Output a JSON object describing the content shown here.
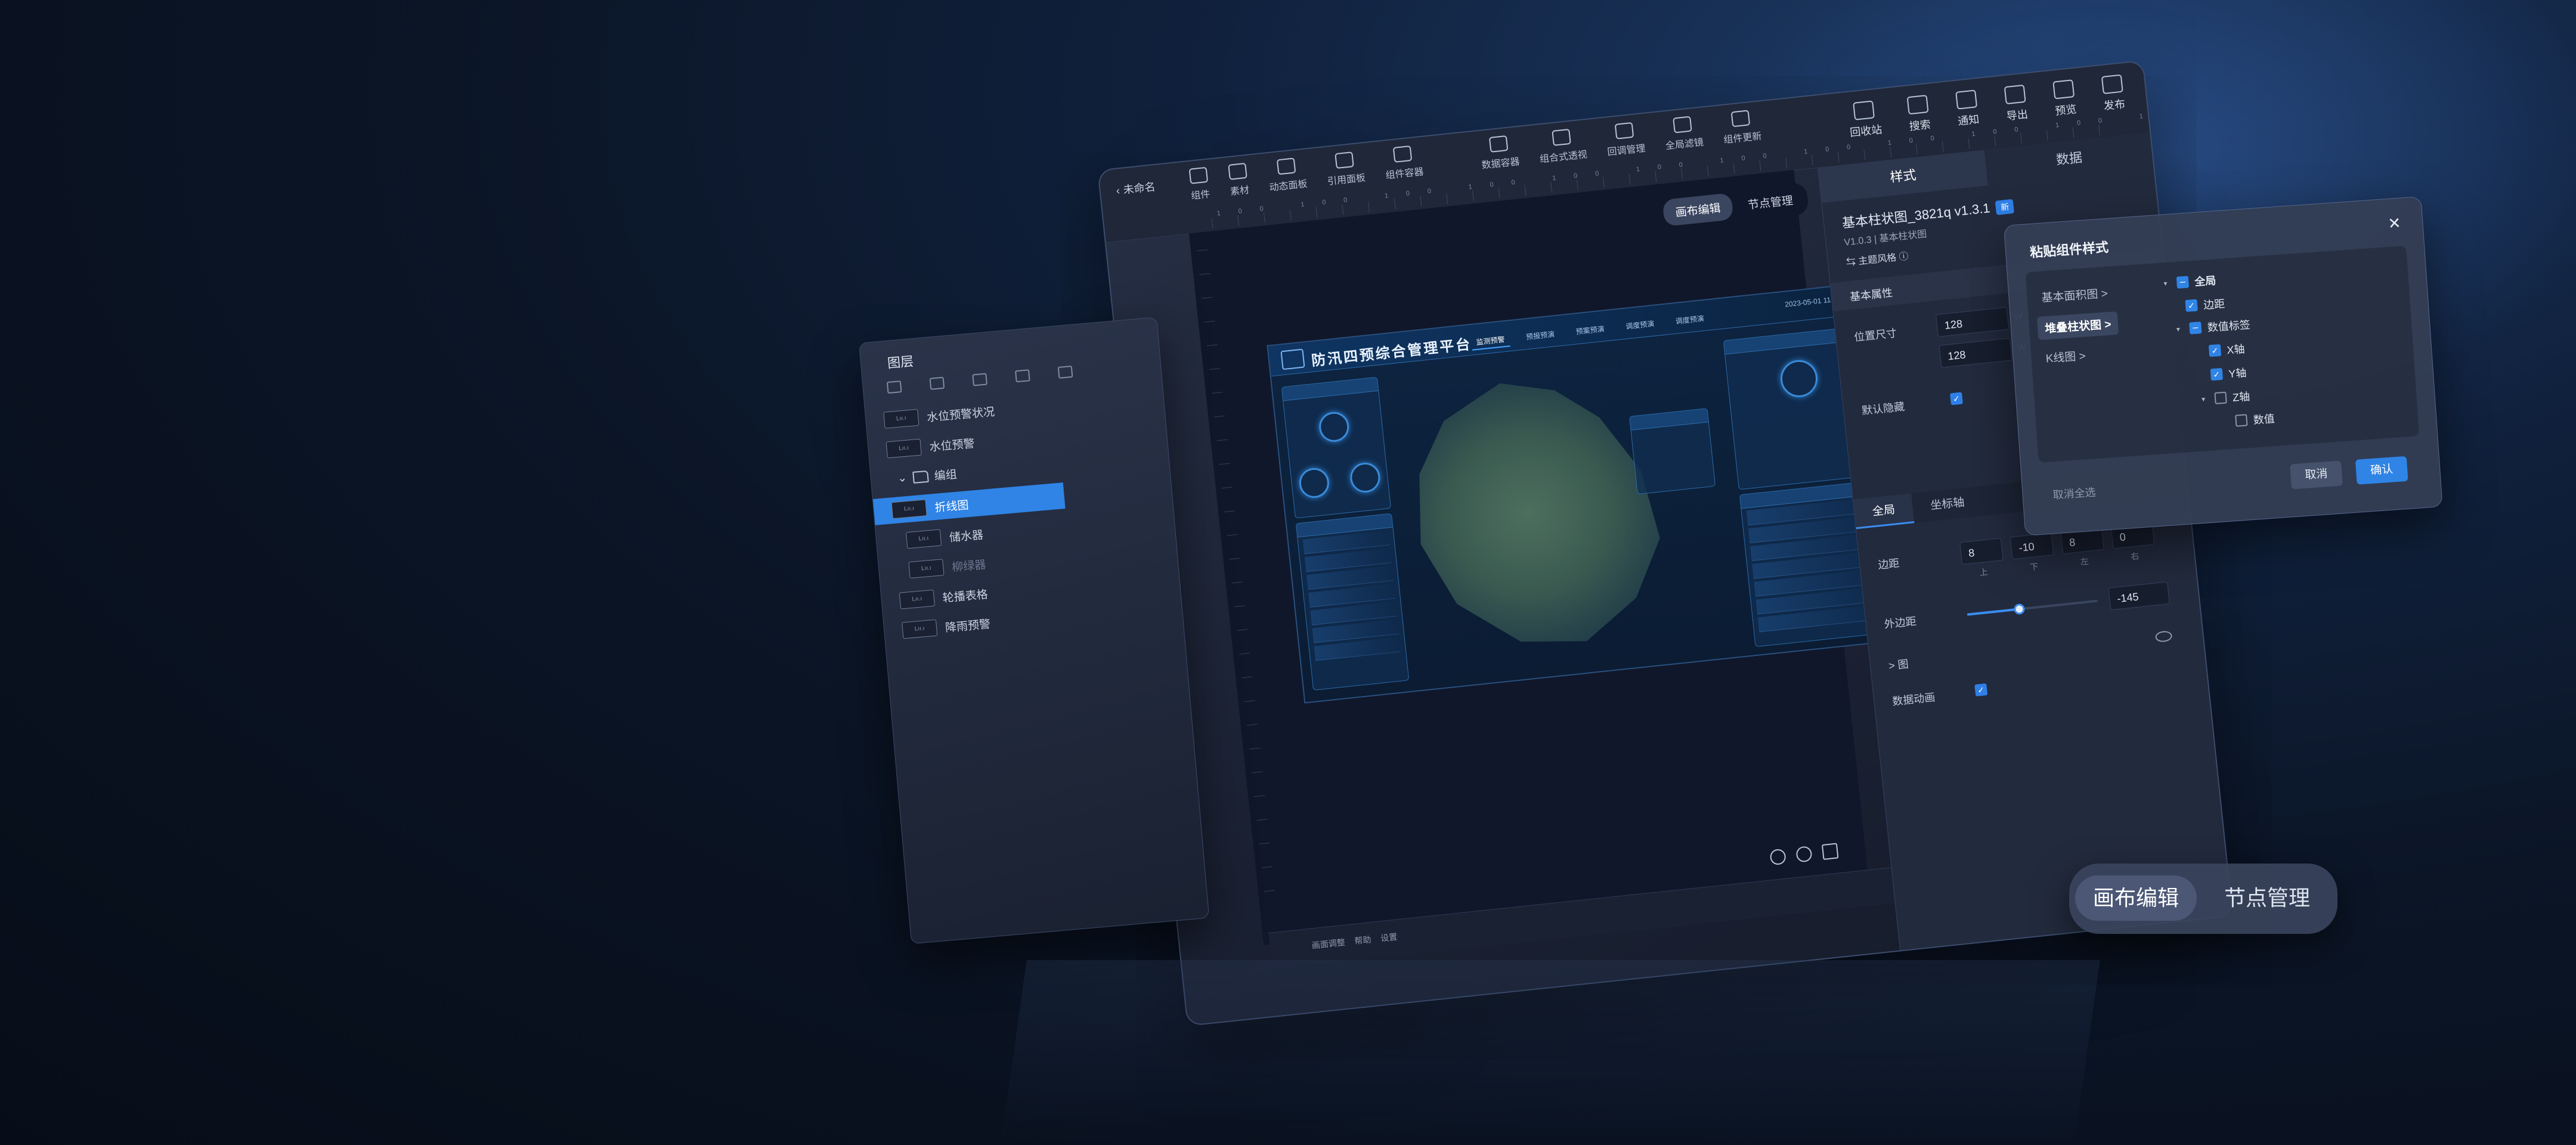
{
  "main": {
    "back_label": "未命名",
    "toolbar_left": [
      {
        "label": "组件",
        "icon": "component-icon"
      },
      {
        "label": "素材",
        "icon": "assets-icon"
      },
      {
        "label": "动态面板",
        "icon": "dynamic-panel-icon"
      },
      {
        "label": "引用面板",
        "icon": "reference-panel-icon"
      },
      {
        "label": "组件容器",
        "icon": "component-container-icon"
      }
    ],
    "toolbar_mid": [
      {
        "label": "数据容器",
        "icon": "data-container-icon"
      },
      {
        "label": "组合式透视",
        "icon": "perspective-icon"
      },
      {
        "label": "回调管理",
        "icon": "callback-icon"
      },
      {
        "label": "全局滤镜",
        "icon": "filter-icon"
      },
      {
        "label": "组件更新",
        "icon": "update-icon"
      }
    ],
    "toolbar_right": [
      {
        "label": "回收站",
        "icon": "recycle-bin-icon"
      },
      {
        "label": "搜索",
        "icon": "search-icon"
      },
      {
        "label": "通知",
        "icon": "notification-icon"
      },
      {
        "label": "导出",
        "icon": "export-icon"
      },
      {
        "label": "预览",
        "icon": "preview-icon"
      },
      {
        "label": "发布",
        "icon": "publish-icon"
      }
    ],
    "ruler_numbers": "100 100 100 100 100 100 100 100 100 100 100 100 100 100 100 100 100 100 100",
    "mode_switch": {
      "canvas": "画布编辑",
      "nodes": "节点管理"
    },
    "bottom_links": [
      "画面调整",
      "帮助",
      "设置"
    ]
  },
  "dashboard": {
    "title": "防汛四预综合管理平台",
    "nav": [
      "监测预警",
      "预报预演",
      "预案预演",
      "调度预演",
      "调度预演"
    ],
    "time": "2023-05-01 11:49:15"
  },
  "props": {
    "tabs": [
      "样式",
      "数据"
    ],
    "component_name": "基本柱状图_3821q v1.3.1",
    "badge": "新",
    "version_line": "V1.0.3 | 基本柱状图",
    "theme_label": "主题风格",
    "section_basic": "基本属性",
    "position_size_label": "位置尺寸",
    "width": "128",
    "height": "128",
    "unit_w": "W",
    "default_hidden_label": "默认隐藏",
    "sub_tabs": [
      "全局",
      "坐标轴"
    ],
    "margin_label": "边距",
    "margins": [
      "8",
      "-10",
      "8",
      "0"
    ],
    "margin_sides": [
      "上",
      "下",
      "左",
      "右"
    ],
    "outer_margin_label": "外边距",
    "outer_margin_value": "-145",
    "outer_margin_fill": 0.4,
    "chart_section": "> 图",
    "data_anim_label": "数据动画"
  },
  "layers": {
    "title": "图层",
    "items": [
      {
        "label": "水位预警状况",
        "thumb": "Lıı.ı"
      },
      {
        "label": "水位预警",
        "thumb": "Lıı.ı"
      },
      {
        "label": "折线图",
        "thumb": "Lıı.ı"
      },
      {
        "label": "储水器",
        "thumb": "Lıı.ı"
      },
      {
        "label": "柳绿器",
        "thumb": "Lıı.ı"
      },
      {
        "label": "轮播表格",
        "thumb": "Lıı.ı"
      },
      {
        "label": "降雨预警",
        "thumb": "Lıı.ı"
      }
    ],
    "group_label": "编组"
  },
  "paste_dialog": {
    "title": "粘贴组件样式",
    "categories": [
      "基本面积图 >",
      "堆叠柱状图 >",
      "K线图 >"
    ],
    "tree": {
      "global": "全局",
      "margin": "边距",
      "data_label": "数值标签",
      "x_axis": "X轴",
      "y_axis": "Y轴",
      "z_axis": "Z轴",
      "value": "数值"
    },
    "clear_all": "取消全选",
    "cancel": "取消",
    "confirm": "确认"
  },
  "float_switch": {
    "canvas": "画布编辑",
    "nodes": "节点管理"
  },
  "colors": {
    "accent": "#2f84e6",
    "panel": "#222a3d",
    "background": "#0b1526"
  }
}
